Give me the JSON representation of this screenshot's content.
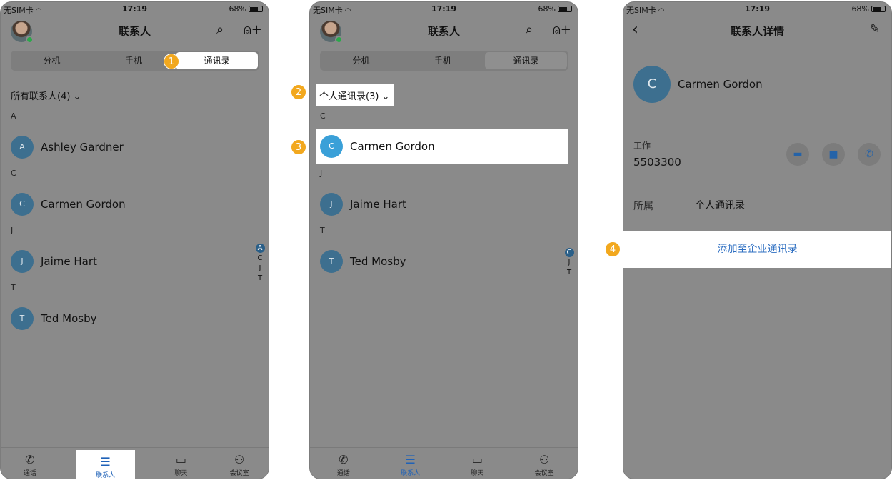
{
  "status": {
    "carrier": "无SIM卡",
    "time": "17:19",
    "battery": "68%"
  },
  "colors": {
    "accent": "#1f62b8",
    "avatar": "#3d6f8f",
    "badge": "#f2a81e"
  },
  "screen1": {
    "title": "联系人",
    "segments": [
      "分机",
      "手机",
      "通讯录"
    ],
    "filter": "所有联系人(4) ⌄",
    "sections": [
      {
        "letter": "A",
        "contacts": [
          {
            "initial": "A",
            "name": "Ashley Gardner"
          }
        ]
      },
      {
        "letter": "C",
        "contacts": [
          {
            "initial": "C",
            "name": "Carmen Gordon"
          }
        ]
      },
      {
        "letter": "J",
        "contacts": [
          {
            "initial": "J",
            "name": "Jaime Hart"
          }
        ]
      },
      {
        "letter": "T",
        "contacts": [
          {
            "initial": "T",
            "name": "Ted Mosby"
          }
        ]
      }
    ],
    "index": [
      "A",
      "C",
      "J",
      "T"
    ],
    "badge": "1"
  },
  "screen2": {
    "title": "联系人",
    "segments": [
      "分机",
      "手机",
      "通讯录"
    ],
    "filter": "个人通讯录(3) ⌄",
    "sections": [
      {
        "letter": "C",
        "contacts": [
          {
            "initial": "C",
            "name": "Carmen Gordon"
          }
        ]
      },
      {
        "letter": "J",
        "contacts": [
          {
            "initial": "J",
            "name": "Jaime Hart"
          }
        ]
      },
      {
        "letter": "T",
        "contacts": [
          {
            "initial": "T",
            "name": "Ted Mosby"
          }
        ]
      }
    ],
    "index": [
      "C",
      "J",
      "T"
    ],
    "badges": [
      "2",
      "3"
    ]
  },
  "screen3": {
    "title": "联系人详情",
    "initial": "C",
    "name": "Carmen Gordon",
    "work_label": "工作",
    "work_number": "5503300",
    "belong_label": "所属",
    "belong_value": "个人通讯录",
    "add_button": "添加至企业通讯录",
    "badge": "4"
  },
  "tabs": [
    "通话",
    "联系人",
    "聊天",
    "会议室"
  ]
}
